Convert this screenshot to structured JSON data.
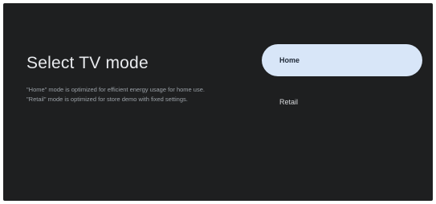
{
  "screen": {
    "title": "Select TV mode",
    "description": [
      "\"Home\" mode is optimized for efficient energy usage for home use.",
      "\"Retail\" mode is optimized for store demo with fixed settings."
    ]
  },
  "options": [
    {
      "label": "Home",
      "selected": true
    },
    {
      "label": "Retail",
      "selected": false
    }
  ],
  "colors": {
    "background": "#1e1f20",
    "selected_option_bg": "#d8e6f8",
    "title_text": "#e8eaed",
    "description_text": "#9aa0a6"
  }
}
